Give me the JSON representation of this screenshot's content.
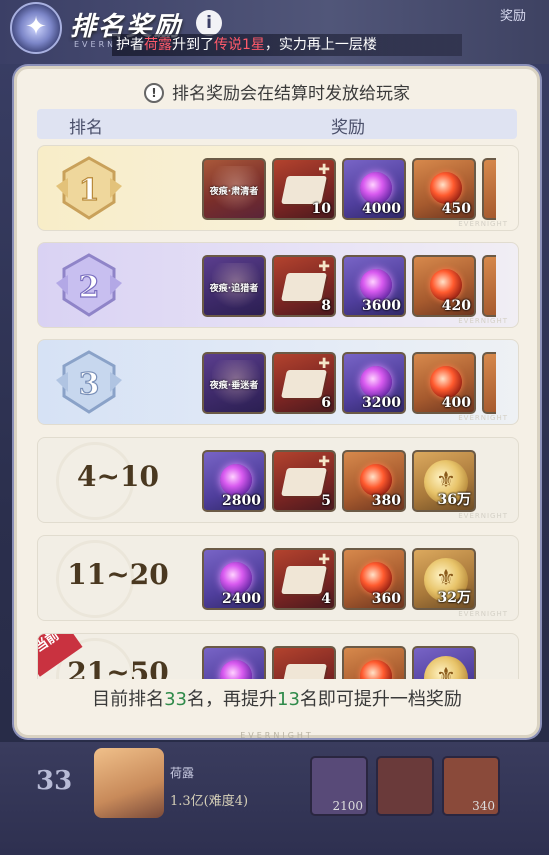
{
  "header": {
    "title": "排名奖励",
    "info_icon": "i",
    "brand": "EVERNIGHT",
    "right_label": "奖励"
  },
  "marquee": {
    "prefix": "护者",
    "name": "荷露",
    "mid": "升到了",
    "rank": "传说1星",
    "suffix": "，实力再上一层楼"
  },
  "panel": {
    "notice_icon": "!",
    "notice": "排名奖励会在结算时发放给玩家",
    "col_rank": "排名",
    "col_reward": "奖励",
    "row_brand": "EVERNIGHT",
    "current_tag": "当前",
    "footer_a": "目前排名",
    "footer_rank": "33",
    "footer_b": "名，再提升",
    "footer_gap": "13",
    "footer_c": "名即可提升一档奖励",
    "footer_brand": "EVERNIGHT"
  },
  "rows": [
    {
      "rank_label": "1",
      "card_title": "夜痕·肃清者",
      "book_qty": "10",
      "orb_qty": "4000",
      "red_qty": "450"
    },
    {
      "rank_label": "2",
      "card_title": "夜痕·追猎者",
      "book_qty": "8",
      "orb_qty": "3600",
      "red_qty": "420"
    },
    {
      "rank_label": "3",
      "card_title": "夜痕·垂迷者",
      "book_qty": "6",
      "orb_qty": "3200",
      "red_qty": "400"
    },
    {
      "rank_label": "4~10",
      "orb_qty": "2800",
      "book_qty": "5",
      "red_qty": "380",
      "coin_qty": "36万"
    },
    {
      "rank_label": "11~20",
      "orb_qty": "2400",
      "book_qty": "4",
      "red_qty": "360",
      "coin_qty": "32万"
    },
    {
      "rank_label": "21~50"
    }
  ],
  "behind": {
    "rank": "33",
    "name": "荷露",
    "score": "1.3亿(难度4)",
    "orb_qty": "2100",
    "red_qty": "340"
  }
}
